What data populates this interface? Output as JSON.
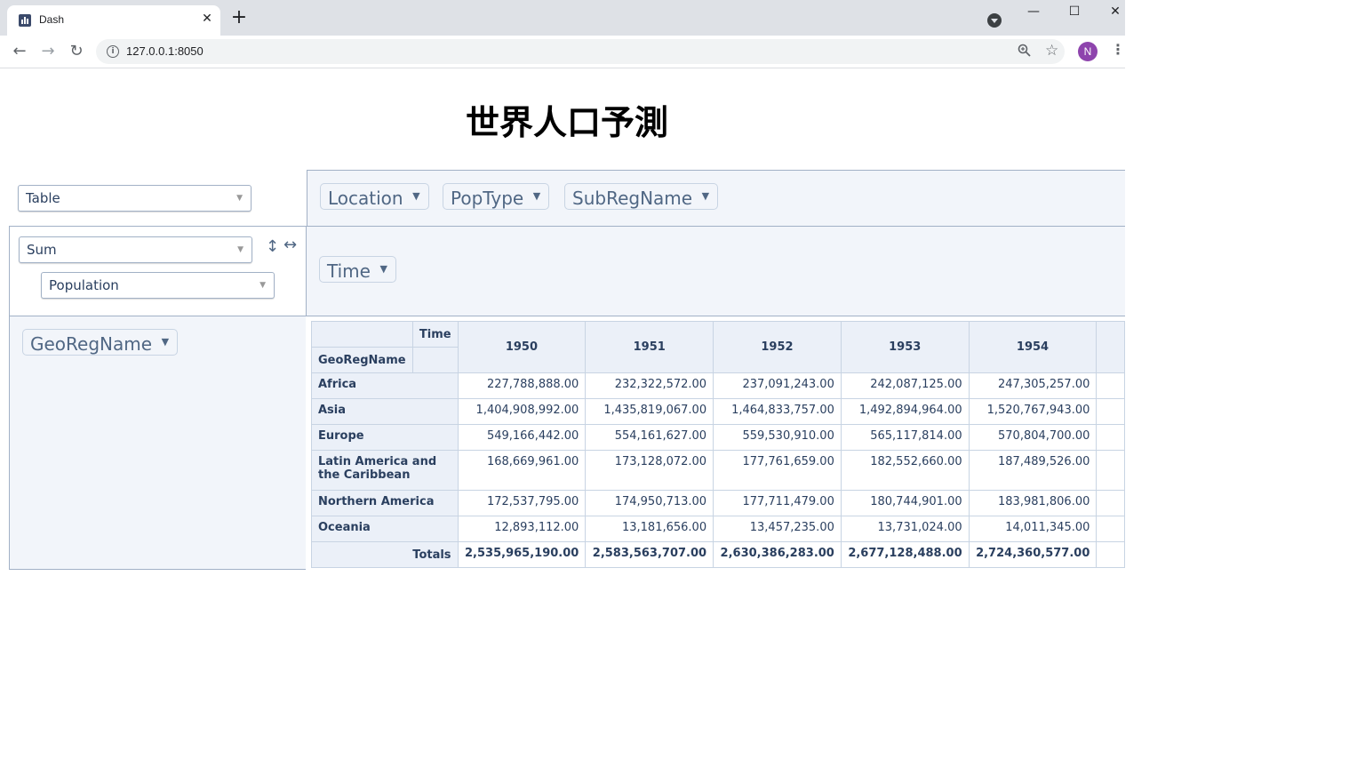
{
  "browser": {
    "tab_title": "Dash",
    "url": "127.0.0.1:8050",
    "avatar_letter": "N"
  },
  "page": {
    "title": "世界人口予測"
  },
  "pivot": {
    "renderer": "Table",
    "aggregator": "Sum",
    "value_field": "Population",
    "unused_attributes": [
      "Location",
      "PopType",
      "SubRegName"
    ],
    "col_attributes": [
      "Time"
    ],
    "row_attributes": [
      "GeoRegName"
    ],
    "table": {
      "col_axis_label": "Time",
      "row_axis_label": "GeoRegName",
      "columns": [
        "1950",
        "1951",
        "1952",
        "1953",
        "1954"
      ],
      "rows": [
        {
          "label": "Africa",
          "values": [
            "227,788,888.00",
            "232,322,572.00",
            "237,091,243.00",
            "242,087,125.00",
            "247,305,257.00"
          ]
        },
        {
          "label": "Asia",
          "values": [
            "1,404,908,992.00",
            "1,435,819,067.00",
            "1,464,833,757.00",
            "1,492,894,964.00",
            "1,520,767,943.00"
          ]
        },
        {
          "label": "Europe",
          "values": [
            "549,166,442.00",
            "554,161,627.00",
            "559,530,910.00",
            "565,117,814.00",
            "570,804,700.00"
          ]
        },
        {
          "label": "Latin America and the Caribbean",
          "values": [
            "168,669,961.00",
            "173,128,072.00",
            "177,761,659.00",
            "182,552,660.00",
            "187,489,526.00"
          ]
        },
        {
          "label": "Northern America",
          "values": [
            "172,537,795.00",
            "174,950,713.00",
            "177,711,479.00",
            "180,744,901.00",
            "183,981,806.00"
          ]
        },
        {
          "label": "Oceania",
          "values": [
            "12,893,112.00",
            "13,181,656.00",
            "13,457,235.00",
            "13,731,024.00",
            "14,011,345.00"
          ]
        }
      ],
      "totals_label": "Totals",
      "totals": [
        "2,535,965,190.00",
        "2,583,563,707.00",
        "2,630,386,283.00",
        "2,677,128,488.00",
        "2,724,360,577.00"
      ]
    }
  }
}
